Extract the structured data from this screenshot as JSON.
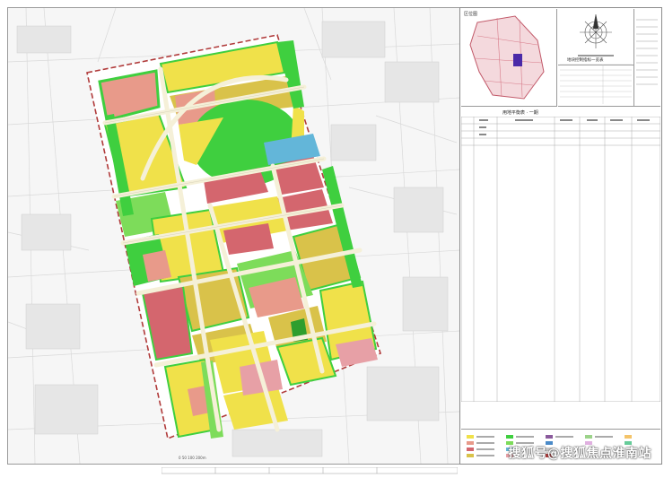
{
  "map": {
    "inset_label": "区位图",
    "indicator_title": "地块控制指标一览表",
    "table_title": "用地平衡表 · 一期"
  },
  "watermark": {
    "text": "搜狐号@搜狐焦点淮南站"
  },
  "colors": {
    "residential": "#f0e14a",
    "commercial": "#e89a8a",
    "mixed": "#d9c24a",
    "green": "#3fcf3f",
    "green_light": "#7ddc5a",
    "public": "#d4666e",
    "school": "#e7a0a6",
    "water": "#63b6d9",
    "road": "#f5f0d8",
    "boundary": "#b03a3a"
  }
}
